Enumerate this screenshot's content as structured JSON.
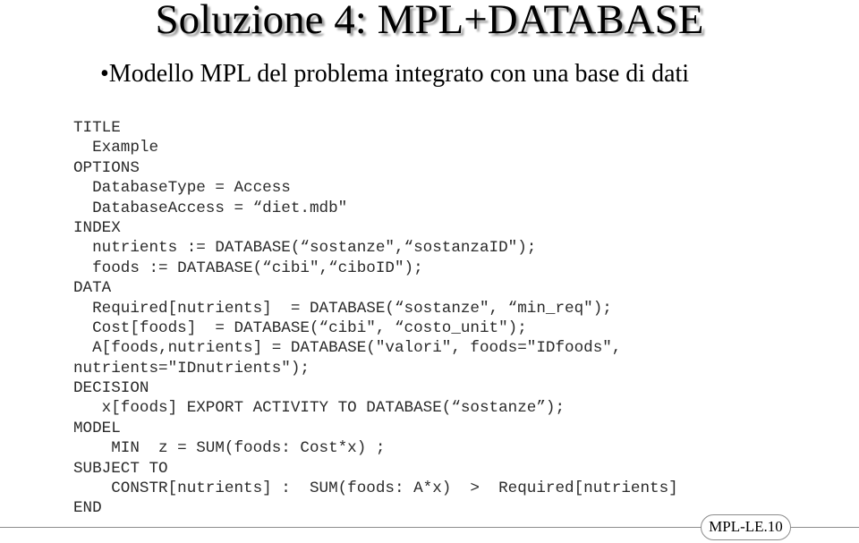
{
  "slide": {
    "title": "Soluzione 4: MPL+DATABASE",
    "subtitle": "•Modello MPL del problema integrato con una base di dati",
    "page_label": "MPL-LE.10"
  },
  "code": {
    "lines": [
      "TITLE",
      "  Example",
      "OPTIONS",
      "  DatabaseType = Access",
      "  DatabaseAccess = “diet.mdb\"",
      "INDEX",
      "  nutrients := DATABASE(“sostanze\",“sostanzaID\");",
      "  foods := DATABASE(“cibi\",“ciboID\");",
      "DATA",
      "  Required[nutrients]  = DATABASE(“sostanze\", “min_req\");",
      "  Cost[foods]  = DATABASE(“cibi\", “costo_unit\");",
      "  A[foods,nutrients] = DATABASE(\"valori\", foods=\"IDfoods\",",
      "nutrients=\"IDnutrients\");",
      "DECISION",
      "   x[foods] EXPORT ACTIVITY TO DATABASE(“sostanze”);",
      "MODEL",
      "    MIN  z = SUM(foods: Cost*x) ;",
      "SUBJECT TO",
      "    CONSTR[nutrients] :  SUM(foods: A*x)  >  Required[nutrients]",
      "END"
    ]
  }
}
